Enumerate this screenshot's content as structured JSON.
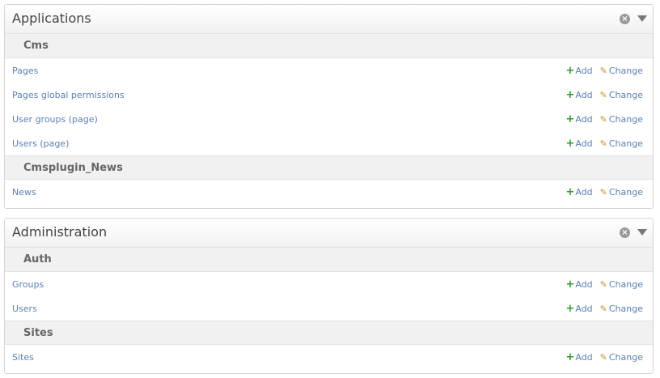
{
  "icons": {
    "close": "close-icon",
    "collapse": "chevron-down-icon",
    "add": "plus-icon",
    "change": "pencil-icon"
  },
  "colors": {
    "link": "#5b80b2",
    "add": "#2e9b2e",
    "change": "#c8912c"
  },
  "action_labels": {
    "add": "Add",
    "change": "Change"
  },
  "modules": [
    {
      "title": "Applications",
      "groups": [
        {
          "name": "Cms",
          "items": [
            "Pages",
            "Pages global permissions",
            "User groups (page)",
            "Users (page)"
          ]
        },
        {
          "name": "Cmsplugin_News",
          "items": [
            "News"
          ]
        }
      ]
    },
    {
      "title": "Administration",
      "groups": [
        {
          "name": "Auth",
          "items": [
            "Groups",
            "Users"
          ]
        },
        {
          "name": "Sites",
          "items": [
            "Sites"
          ]
        }
      ]
    }
  ]
}
